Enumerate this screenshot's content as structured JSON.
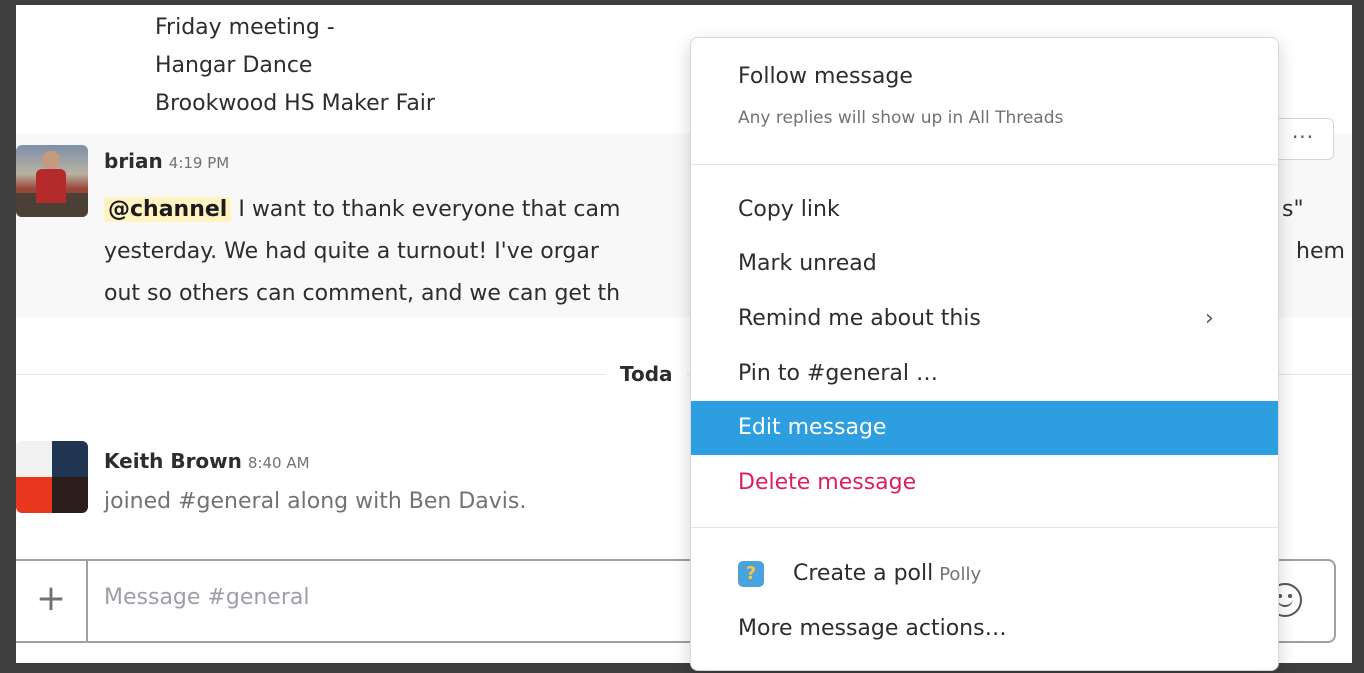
{
  "topic": {
    "lines": [
      "Friday meeting -",
      "Hangar Dance",
      "Brookwood HS Maker Fair"
    ]
  },
  "messages": {
    "brian": {
      "author": "brian",
      "time": "4:19 PM",
      "mention": "@channel",
      "line1": " I want to thank everyone that cam",
      "line1_tail": "s\"",
      "line2": "yesterday.  We had quite a turnout!  I've orgar",
      "line2_tail": "hem",
      "line3": "out so others can comment, and we can get th"
    },
    "keith": {
      "author": "Keith Brown",
      "time": "8:40 AM",
      "text": "joined #general along with Ben Davis."
    }
  },
  "divider": {
    "label": "Toda"
  },
  "actions": {
    "more_label": "···"
  },
  "composer": {
    "plus_label": "+",
    "placeholder": "Message #general",
    "emoji_icon": "smiley-icon"
  },
  "menu": {
    "follow_title": "Follow message",
    "follow_sub": "Any replies will show up in All Threads",
    "items": [
      {
        "label": "Copy link"
      },
      {
        "label": "Mark unread"
      },
      {
        "label": "Remind me about this",
        "chevron": "›"
      },
      {
        "label": "Pin to #general …"
      },
      {
        "label": "Edit message"
      },
      {
        "label": "Delete message"
      }
    ],
    "poll": {
      "label": "Create a poll",
      "app": "Polly",
      "icon": "polly-icon"
    },
    "more": "More message actions…",
    "colors": {
      "highlight": "#2d9ee0",
      "danger": "#e01e5a"
    }
  }
}
